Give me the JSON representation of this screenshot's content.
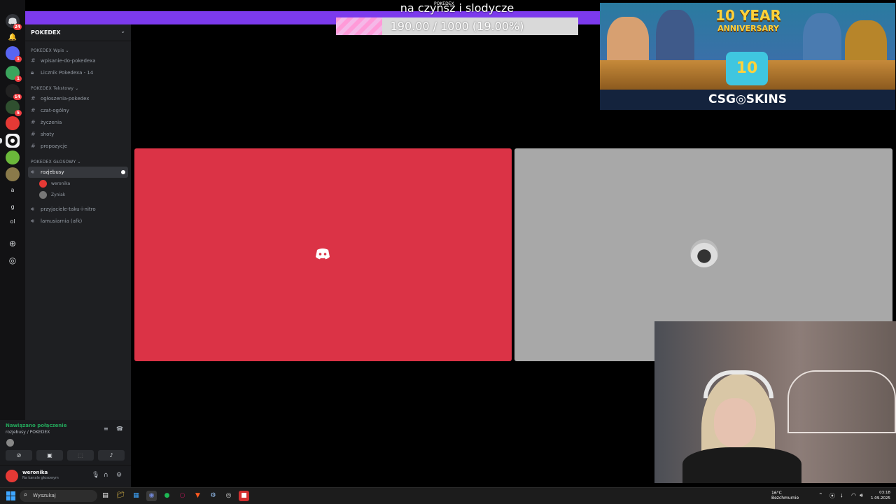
{
  "servers": {
    "items": [
      {
        "name": "discord-home",
        "badge": "24",
        "color": "#313338"
      },
      {
        "name": "server-1",
        "badge": "1",
        "color": "#5865f2"
      },
      {
        "name": "server-2",
        "badge": "1",
        "color": "#3ba55d"
      },
      {
        "name": "server-3",
        "badge": "14",
        "color": "#222"
      },
      {
        "name": "server-4",
        "badge": "5",
        "color": "#2f4f2f"
      },
      {
        "name": "server-5",
        "badge": "",
        "color": "#e53935"
      },
      {
        "name": "server-pokedex",
        "badge": "",
        "color": "#f2f3f5"
      },
      {
        "name": "server-7",
        "badge": "",
        "color": "#6bb83a"
      },
      {
        "name": "server-8",
        "badge": "",
        "color": "#8a7a4a"
      }
    ],
    "letters": [
      "a",
      "g",
      "ol"
    ]
  },
  "guild": {
    "name": "POKEDEX"
  },
  "categories": [
    {
      "label": "POKEDEX Wpis"
    },
    {
      "label": "POKEDEX Tekstowy"
    },
    {
      "label": "POKEDEX GŁOSOWY"
    }
  ],
  "channels": [
    {
      "label": "wpisanie-do-pokedexa",
      "type": "text"
    },
    {
      "label": "Licznik Pokedexa - 14",
      "type": "locked"
    },
    {
      "label": "ogłoszenia-pokedex",
      "type": "text"
    },
    {
      "label": "czat-ogólny",
      "type": "text"
    },
    {
      "label": "życzenia",
      "type": "text"
    },
    {
      "label": "shoty",
      "type": "text"
    },
    {
      "label": "propozycje",
      "type": "text"
    },
    {
      "label": "rozjebusy",
      "type": "voice",
      "active": true
    },
    {
      "label": "przyjaciele-taku-i-nitro",
      "type": "voice"
    },
    {
      "label": "lamusiarnia (afk)",
      "type": "voice"
    }
  ],
  "voice_users": [
    {
      "name": "weronika",
      "color": "#e53935"
    },
    {
      "name": "Zyniak",
      "color": "#777"
    }
  ],
  "voice_panel": {
    "status": "Nawiązano połączenie",
    "channel": "rozjebusy / POKEDEX"
  },
  "user": {
    "name": "weronika",
    "status": "Na kanale głosowym"
  },
  "overlay": {
    "title": "na czynsz i slodycze",
    "subtitle": "POKEDEX",
    "progress_text": "190.00 / 1000 (19.00%)",
    "progress_fraction": 0.19
  },
  "banner": {
    "anniversary_big": "10 YEAR",
    "anniversary_small": "ANNIVERSARY",
    "cake_text": "10",
    "brand": "CSG◎SKINS"
  },
  "taskbar": {
    "search_placeholder": "Wyszukaj",
    "weather_temp": "16°C",
    "weather_desc": "Bezchmurnie",
    "time": "03:18",
    "date": "1.09.2025"
  },
  "colors": {
    "accent_purple": "#7c3aed",
    "tile_red": "#db3346",
    "tile_gray": "#a8a8a8",
    "connected_green": "#23a55a"
  }
}
